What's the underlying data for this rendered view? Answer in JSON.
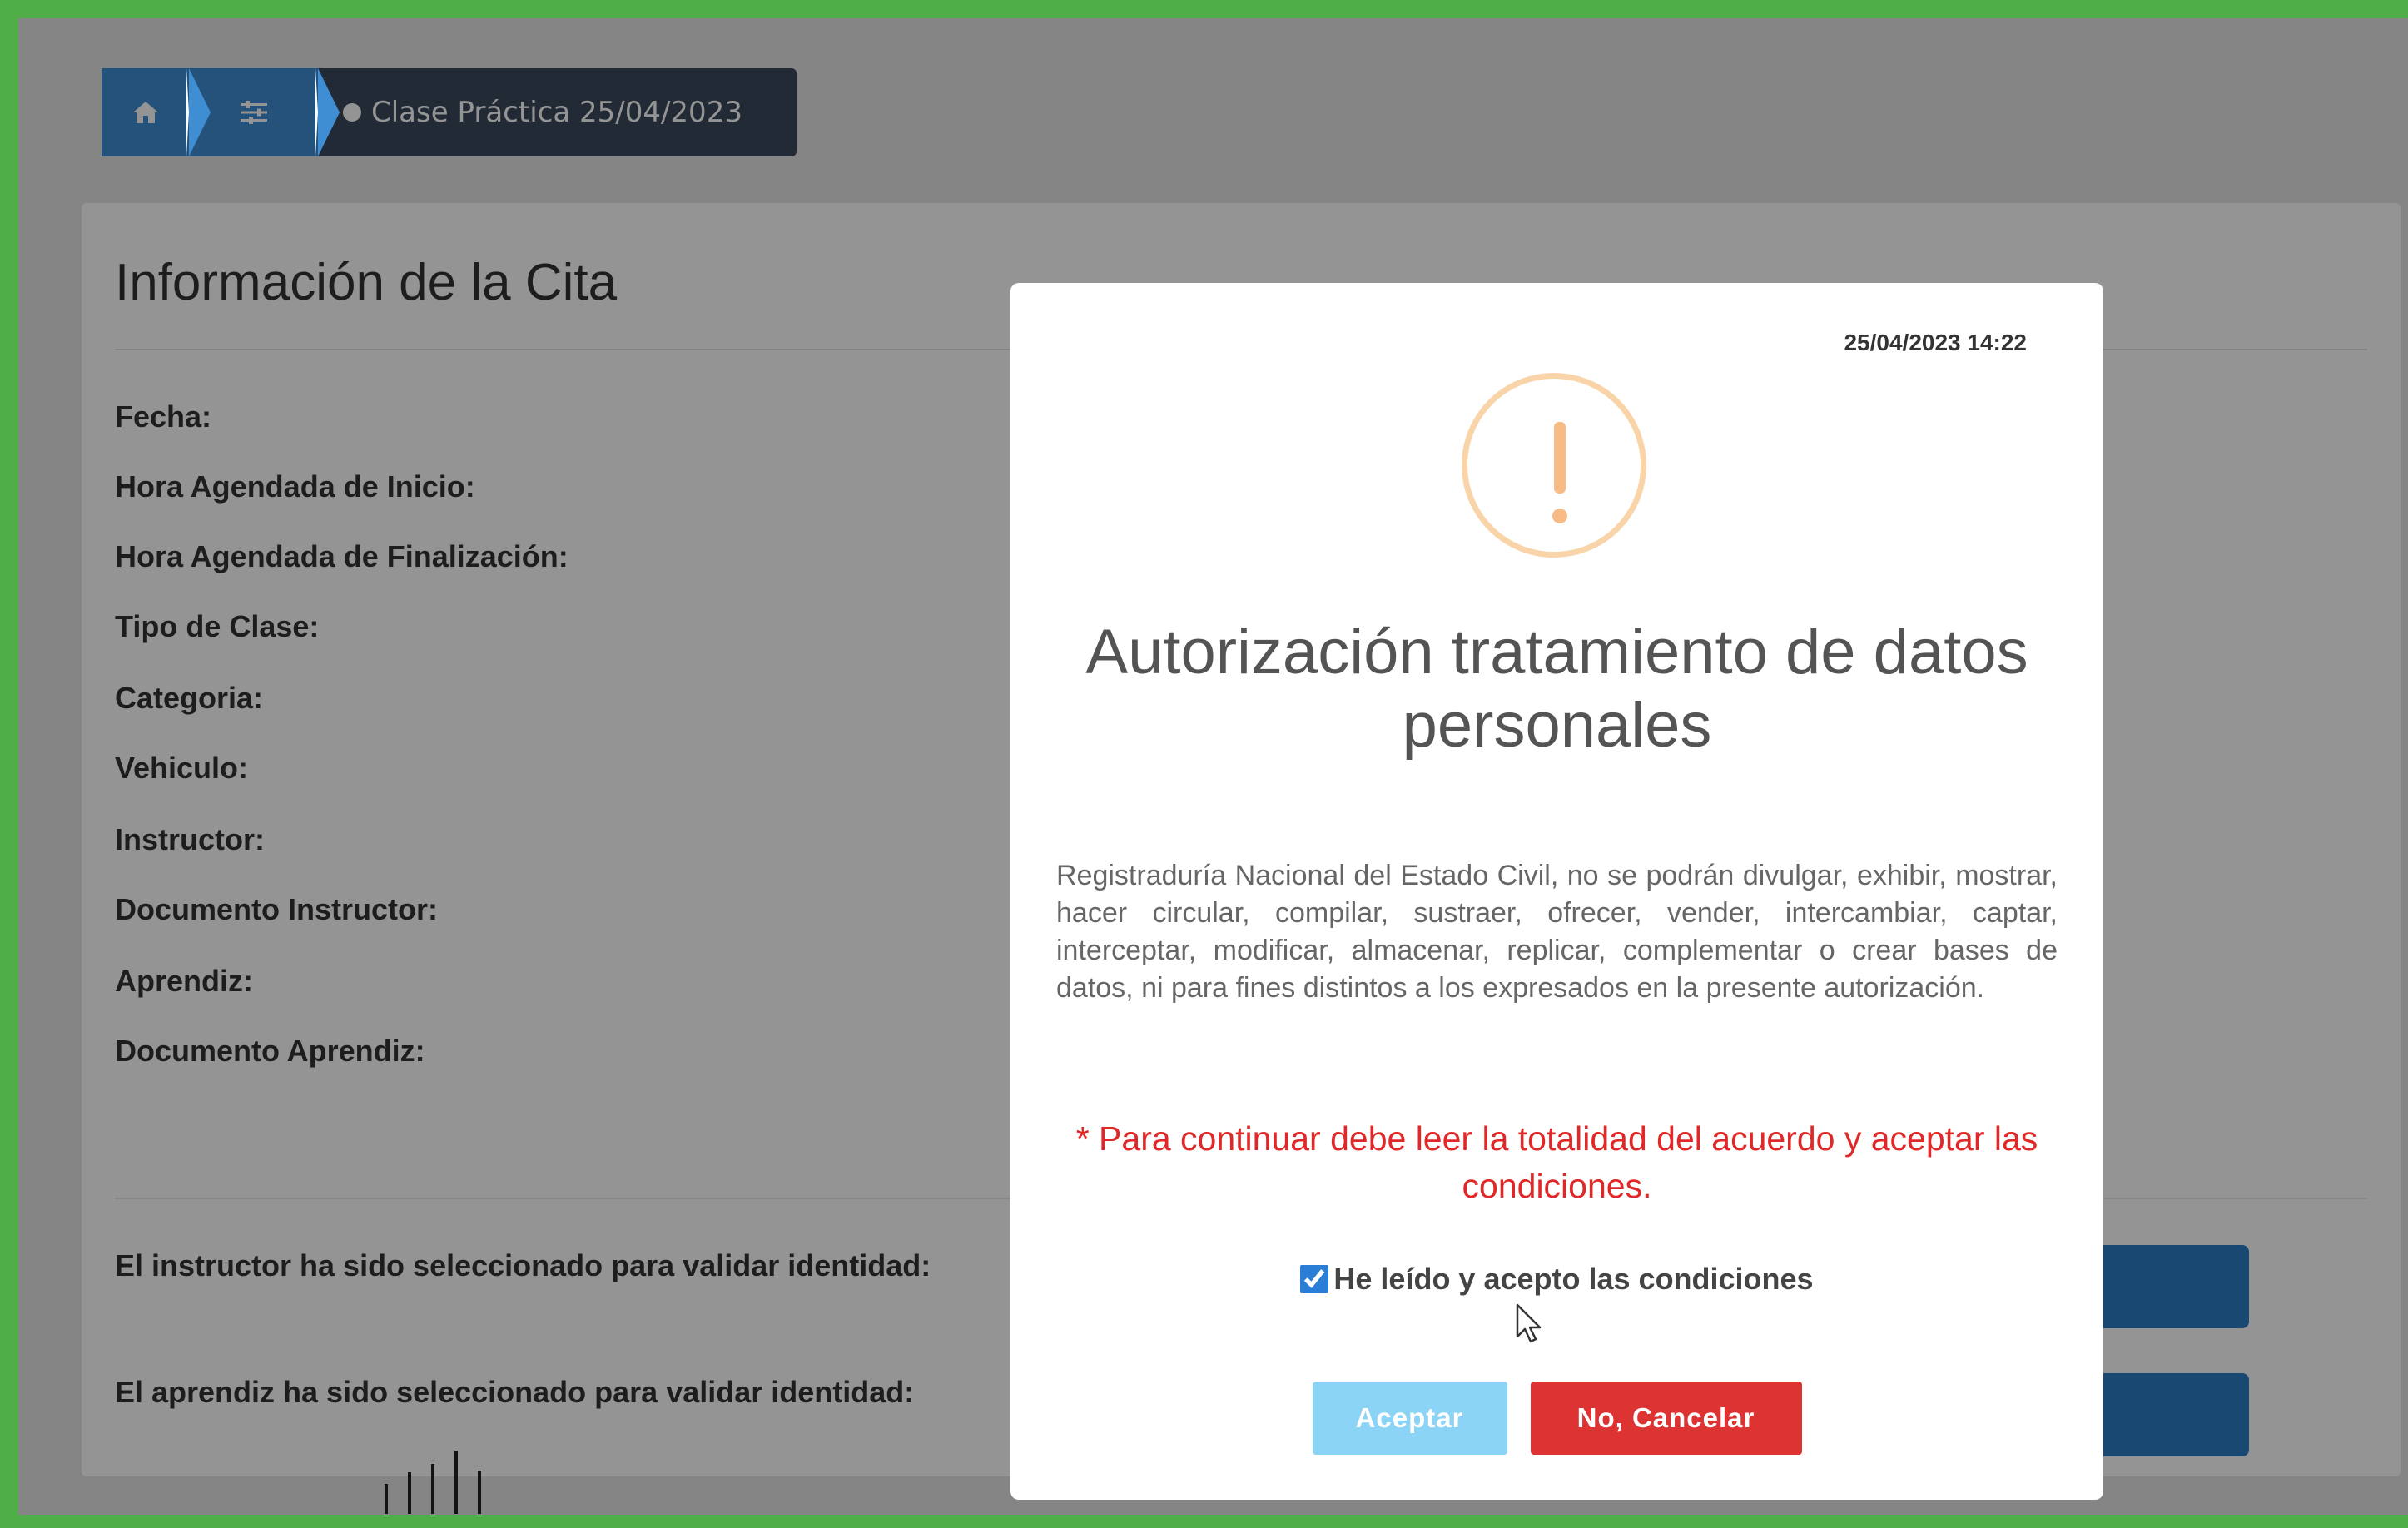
{
  "breadcrumb": {
    "home_icon": "home-icon",
    "filter_icon": "sliders-icon",
    "current": "Clase Práctica 25/04/2023"
  },
  "panel": {
    "title": "Información de la Cita",
    "fields": [
      "Fecha:",
      "Hora Agendada de Inicio:",
      "Hora Agendada de Finalización:",
      "Tipo de Clase:",
      "Categoria:",
      "Vehiculo:",
      "Instructor:",
      "Documento Instructor:",
      "Aprendiz:",
      "Documento Aprendiz:"
    ],
    "instructor_validation": "El instructor ha sido seleccionado para validar identidad:",
    "learner_validation": "El aprendiz ha sido seleccionado para validar identidad:"
  },
  "modal": {
    "timestamp": "25/04/2023 14:22",
    "icon": "warning-icon",
    "title": "Autorización tratamiento de datos personales",
    "body": "Registraduría Nacional del Estado Civil, no se podrán divulgar, exhibir, mostrar, hacer circular, compilar, sustraer, ofrecer, vender, intercambiar, captar, interceptar, modificar, almacenar, replicar, complementar o crear bases de datos, ni para fines distintos a los expresados en la presente autorización.",
    "warning": "* Para continuar debe leer la totalidad del acuerdo y aceptar las condiciones.",
    "checkbox_label": "He leído y acepto las condiciones",
    "checkbox_checked": true,
    "accept_label": "Aceptar",
    "cancel_label": "No, Cancelar"
  },
  "colors": {
    "frame_green": "#4fae47",
    "breadcrumb_blue": "#3f8ed3",
    "breadcrumb_dark": "#3c4a5c",
    "warning_orange": "#f8bb86",
    "warning_red": "#e02828",
    "accept_button": "#8cd4f5",
    "cancel_button": "#dd3333"
  }
}
